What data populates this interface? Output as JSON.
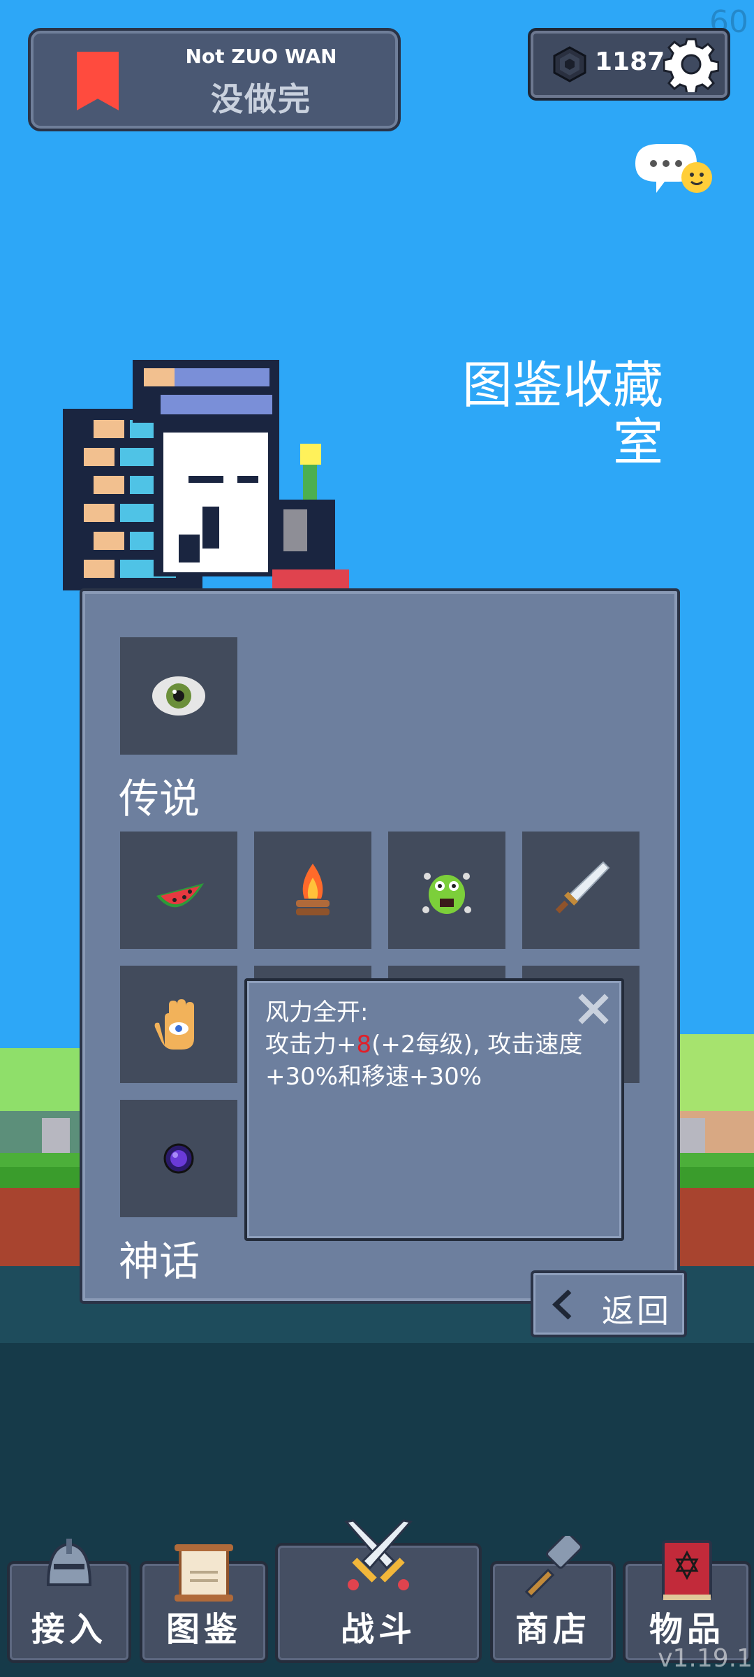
{
  "status": {
    "fps": "60"
  },
  "user": {
    "name_en": "Not ZUO WAN",
    "name_cn": "没做完"
  },
  "currency": {
    "value": "1187",
    "icon": "gem-icon"
  },
  "page": {
    "title_line1": "图鉴收藏",
    "title_line2": "室"
  },
  "collection": {
    "top_item": {
      "icon": "eye-icon"
    },
    "legendary": {
      "label": "传说",
      "items": [
        {
          "icon": "watermelon-icon"
        },
        {
          "icon": "campfire-icon"
        },
        {
          "icon": "green-monster-icon"
        },
        {
          "icon": "sword-icon"
        },
        {
          "icon": "hand-eye-icon"
        },
        {
          "icon": "dark-orb-icon"
        }
      ]
    },
    "mythic": {
      "label": "神话"
    }
  },
  "tooltip": {
    "title": "风力全开:",
    "desc_prefix": "攻击力+",
    "desc_highlight": "8",
    "desc_suffix": "(+2每级), 攻击速度+30%和移速+30%",
    "highlight_color": "#e0202a"
  },
  "back_button": {
    "label": "返回"
  },
  "nav": {
    "items": [
      {
        "label": "接入",
        "icon": "helmet-icon"
      },
      {
        "label": "图鉴",
        "icon": "scroll-icon"
      },
      {
        "label": "战斗",
        "icon": "crossed-swords-icon"
      },
      {
        "label": "商店",
        "icon": "hammer-icon"
      },
      {
        "label": "物品",
        "icon": "spellbook-icon"
      }
    ]
  },
  "version": "v1.19.1",
  "colors": {
    "sky": "#2da7f7",
    "panel": "#6d7f9e",
    "slot": "#424b5c",
    "accent_red": "#ff4b3e"
  }
}
